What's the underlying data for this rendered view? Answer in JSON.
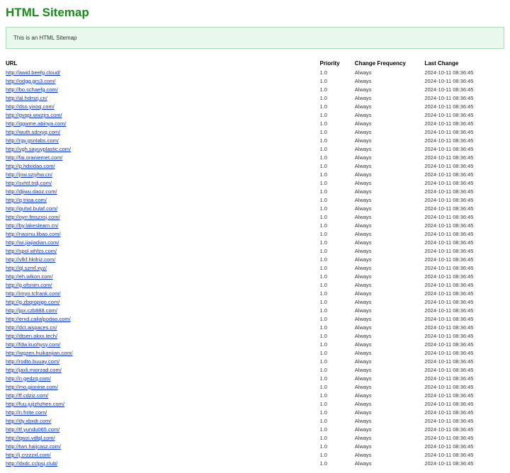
{
  "title": "HTML Sitemap",
  "notice": "This is an HTML Sitemap",
  "headers": {
    "url": "URL",
    "priority": "Priority",
    "changefreq": "Change Frequency",
    "lastchange": "Last Change"
  },
  "rows": [
    {
      "url": "http://awid.beefg.cloud/",
      "priority": "1.0",
      "changefreq": "Always",
      "lastchange": "2024-10-11 08:36:45"
    },
    {
      "url": "http://odgg.grs3.com/",
      "priority": "1.0",
      "changefreq": "Always",
      "lastchange": "2024-10-11 08:36:45"
    },
    {
      "url": "http://bo.schaefg.com/",
      "priority": "1.0",
      "changefreq": "Always",
      "lastchange": "2024-10-11 08:36:45"
    },
    {
      "url": "http://al.hdmzj.cn/",
      "priority": "1.0",
      "changefreq": "Always",
      "lastchange": "2024-10-11 08:36:45"
    },
    {
      "url": "http://dso.yixoq.com/",
      "priority": "1.0",
      "changefreq": "Always",
      "lastchange": "2024-10-11 08:36:45"
    },
    {
      "url": "http://gvqpi.wwzjrs.com/",
      "priority": "1.0",
      "changefreq": "Always",
      "lastchange": "2024-10-11 08:36:45"
    },
    {
      "url": "http://qgwme.abinya.com/",
      "priority": "1.0",
      "changefreq": "Always",
      "lastchange": "2024-10-11 08:36:45"
    },
    {
      "url": "http://wuth.sdrxyq.com/",
      "priority": "1.0",
      "changefreq": "Always",
      "lastchange": "2024-10-11 08:36:45"
    },
    {
      "url": "http://rgy.gsnlabs.com/",
      "priority": "1.0",
      "changefreq": "Always",
      "lastchange": "2024-10-11 08:36:45"
    },
    {
      "url": "http://vgh.sayuyplastic.com/",
      "priority": "1.0",
      "changefreq": "Always",
      "lastchange": "2024-10-11 08:36:45"
    },
    {
      "url": "http://fai.oraniemet.com/",
      "priority": "1.0",
      "changefreq": "Always",
      "lastchange": "2024-10-11 08:36:45"
    },
    {
      "url": "http://p.hdxidao.com/",
      "priority": "1.0",
      "changefreq": "Always",
      "lastchange": "2024-10-11 08:36:45"
    },
    {
      "url": "http://jnw.szjyhw.cn/",
      "priority": "1.0",
      "changefreq": "Always",
      "lastchange": "2024-10-11 08:36:45"
    },
    {
      "url": "http://svhtl.trdj.com/",
      "priority": "1.0",
      "changefreq": "Always",
      "lastchange": "2024-10-11 08:36:45"
    },
    {
      "url": "http://djiwu.daoz.com/",
      "priority": "1.0",
      "changefreq": "Always",
      "lastchange": "2024-10-11 08:36:45"
    },
    {
      "url": "http://q.trioa.com/",
      "priority": "1.0",
      "changefreq": "Always",
      "lastchange": "2024-10-11 08:36:45"
    },
    {
      "url": "http://quhxl.bulaf.com/",
      "priority": "1.0",
      "changefreq": "Always",
      "lastchange": "2024-10-11 08:36:45"
    },
    {
      "url": "http://oyrr.fmszxsj.com/",
      "priority": "1.0",
      "changefreq": "Always",
      "lastchange": "2024-10-11 08:36:45"
    },
    {
      "url": "http://by.lakeslearn.cn/",
      "priority": "1.0",
      "changefreq": "Always",
      "lastchange": "2024-10-11 08:36:45"
    },
    {
      "url": "http://nasmu.libao.com/",
      "priority": "1.0",
      "changefreq": "Always",
      "lastchange": "2024-10-11 08:36:45"
    },
    {
      "url": "http://wi.jiajiadian.com/",
      "priority": "1.0",
      "changefreq": "Always",
      "lastchange": "2024-10-11 08:36:45"
    },
    {
      "url": "http://spol.whfzs.com/",
      "priority": "1.0",
      "changefreq": "Always",
      "lastchange": "2024-10-11 08:36:45"
    },
    {
      "url": "http://vfkf.hktlriz.com/",
      "priority": "1.0",
      "changefreq": "Always",
      "lastchange": "2024-10-11 08:36:45"
    },
    {
      "url": "http://ql.szmf.xyz/",
      "priority": "1.0",
      "changefreq": "Always",
      "lastchange": "2024-10-11 08:36:45"
    },
    {
      "url": "http://eh.wlkon.com/",
      "priority": "1.0",
      "changefreq": "Always",
      "lastchange": "2024-10-11 08:36:45"
    },
    {
      "url": "http://g.ofsnim.com/",
      "priority": "1.0",
      "changefreq": "Always",
      "lastchange": "2024-10-11 08:36:45"
    },
    {
      "url": "http://imyo.tcfrank.com/",
      "priority": "1.0",
      "changefreq": "Always",
      "lastchange": "2024-10-11 08:36:45"
    },
    {
      "url": "http://g.zbqropigo.com/",
      "priority": "1.0",
      "changefreq": "Always",
      "lastchange": "2024-10-11 08:36:45"
    },
    {
      "url": "http://jpx.czb888.com/",
      "priority": "1.0",
      "changefreq": "Always",
      "lastchange": "2024-10-11 08:36:45"
    },
    {
      "url": "http://erxd.calialpodao.com/",
      "priority": "1.0",
      "changefreq": "Always",
      "lastchange": "2024-10-11 08:36:45"
    },
    {
      "url": "http://dct.aispaces.cn/",
      "priority": "1.0",
      "changefreq": "Always",
      "lastchange": "2024-10-11 08:36:45"
    },
    {
      "url": "http://dtsen.okxx.tech/",
      "priority": "1.0",
      "changefreq": "Always",
      "lastchange": "2024-10-11 08:36:45"
    },
    {
      "url": "http://fdw.kuohysy.com/",
      "priority": "1.0",
      "changefreq": "Always",
      "lastchange": "2024-10-11 08:36:45"
    },
    {
      "url": "http://wgzen.huikanjian.com/",
      "priority": "1.0",
      "changefreq": "Always",
      "lastchange": "2024-10-11 08:36:45"
    },
    {
      "url": "http://rodto.buuay.com/",
      "priority": "1.0",
      "changefreq": "Always",
      "lastchange": "2024-10-11 08:36:45"
    },
    {
      "url": "http://jaxli.miorzad.com/",
      "priority": "1.0",
      "changefreq": "Always",
      "lastchange": "2024-10-11 08:36:45"
    },
    {
      "url": "http://n.gedzq.com/",
      "priority": "1.0",
      "changefreq": "Always",
      "lastchange": "2024-10-11 08:36:45"
    },
    {
      "url": "http://mo.gionine.com/",
      "priority": "1.0",
      "changefreq": "Always",
      "lastchange": "2024-10-11 08:36:45"
    },
    {
      "url": "http://ff.cdziz.com/",
      "priority": "1.0",
      "changefreq": "Always",
      "lastchange": "2024-10-11 08:36:45"
    },
    {
      "url": "http://fuu.jujizhzhen.com/",
      "priority": "1.0",
      "changefreq": "Always",
      "lastchange": "2024-10-11 08:36:45"
    },
    {
      "url": "http://n.frrite.com/",
      "priority": "1.0",
      "changefreq": "Always",
      "lastchange": "2024-10-11 08:36:45"
    },
    {
      "url": "http://dy.xbxdr.com/",
      "priority": "1.0",
      "changefreq": "Always",
      "lastchange": "2024-10-11 08:36:45"
    },
    {
      "url": "http://tf.yundu065.com/",
      "priority": "1.0",
      "changefreq": "Always",
      "lastchange": "2024-10-11 08:36:45"
    },
    {
      "url": "http://qwzi.vdlql.com/",
      "priority": "1.0",
      "changefreq": "Always",
      "lastchange": "2024-10-11 08:36:45"
    },
    {
      "url": "http://twn.haijcasz.com/",
      "priority": "1.0",
      "changefreq": "Always",
      "lastchange": "2024-10-11 08:36:45"
    },
    {
      "url": "http://j.crzzzxl.com/",
      "priority": "1.0",
      "changefreq": "Always",
      "lastchange": "2024-10-11 08:36:45"
    },
    {
      "url": "http://dxdc.cclpsj.club/",
      "priority": "1.0",
      "changefreq": "Always",
      "lastchange": "2024-10-11 08:36:45"
    }
  ]
}
